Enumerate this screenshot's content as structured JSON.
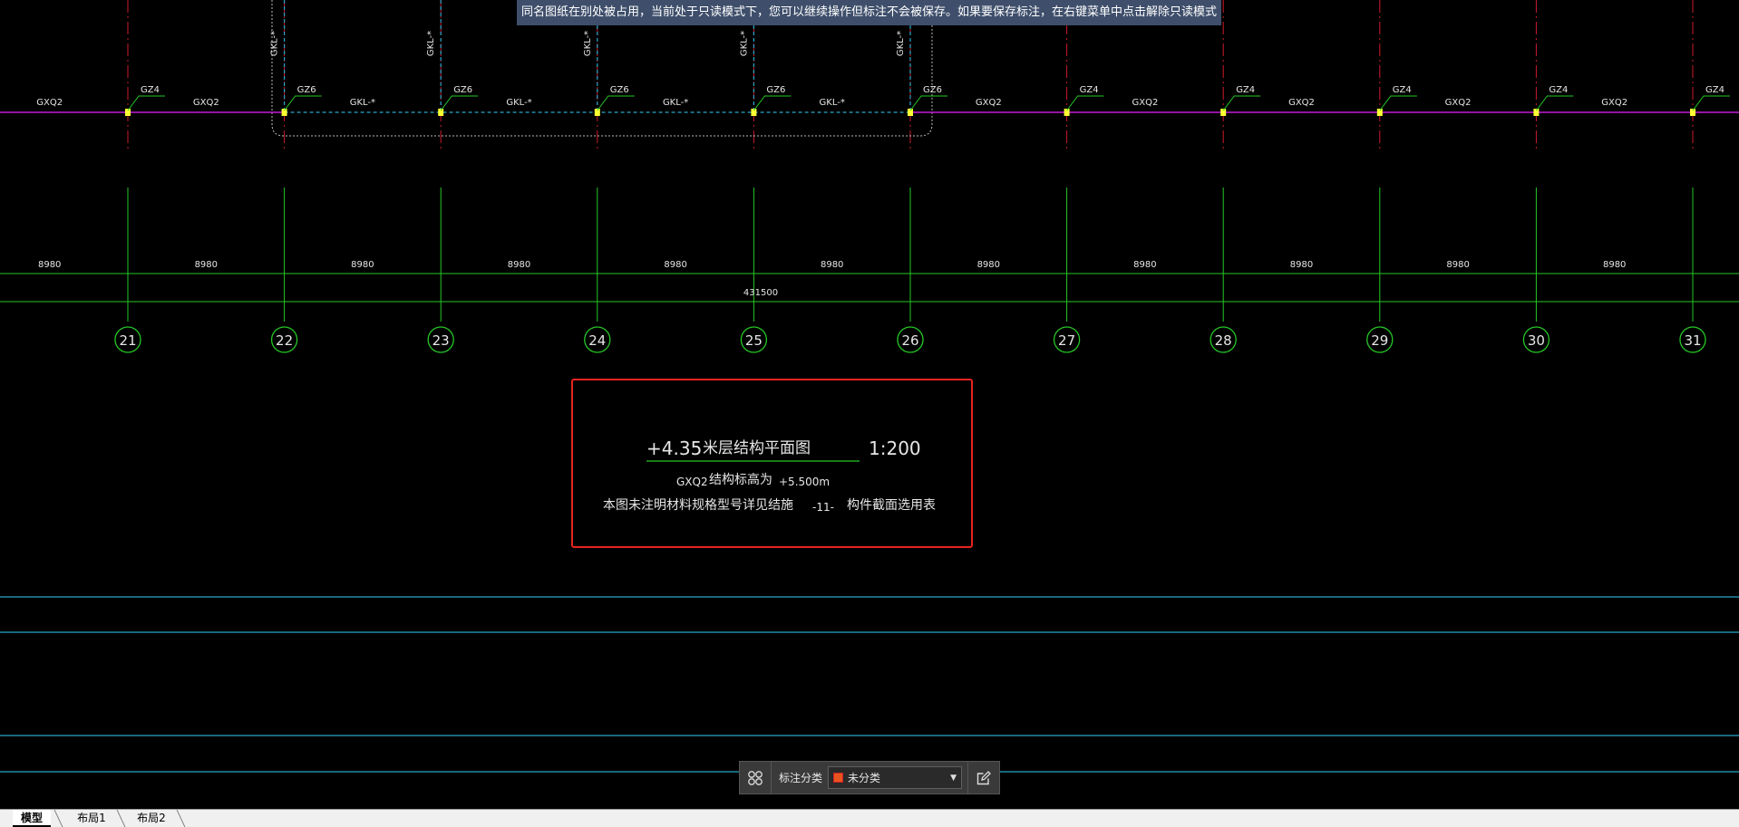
{
  "notice": "同名图纸在别处被占用，当前处于只读模式下，您可以继续操作但标注不会被保存。如果要保存标注，在右键菜单中点击解除只读模式",
  "colors": {
    "background": "#000000",
    "grid_line": "#cc1b2b",
    "beam_line": "#c21ad6",
    "dimension_line": "#25c825",
    "axis_bubble": "#25c825",
    "frame_beam": "#2aa6c9",
    "highlight_box": "#e8231f",
    "column_marker": "#ffff33",
    "text": "#e6e6e6"
  },
  "axes": [
    "21",
    "22",
    "23",
    "24",
    "25",
    "26",
    "27",
    "28",
    "29",
    "30",
    "31"
  ],
  "column_labels": [
    "GZ4",
    "GZ6",
    "GZ6",
    "GZ6",
    "GZ6",
    "GZ6",
    "GZ4",
    "GZ4",
    "GZ4",
    "GZ4",
    "GZ4"
  ],
  "beam_labels": [
    "GXQ2",
    "GXQ2",
    "GKL-*",
    "GKL-*",
    "GKL-*",
    "GKL-*",
    "GXQ2",
    "GXQ2",
    "GXQ2",
    "GXQ2",
    "GXQ2"
  ],
  "vertical_beam_labels": [
    "GKL-*",
    "GKL-*",
    "GKL-*",
    "GKL-*",
    "GKL-*"
  ],
  "span_dims": [
    "8980",
    "8980",
    "8980",
    "8980",
    "8980",
    "8980",
    "8980",
    "8980",
    "8980",
    "8980",
    "8980"
  ],
  "total_dim": "431500",
  "title_block": {
    "elevation": "+4.35",
    "title": "米层结构平面图",
    "scale": "1:200",
    "note1_label": "GXQ2",
    "note1_text": "结构标高为",
    "note1_value": "+5.500m",
    "note2_text": "本图未注明材料规格型号详见结施",
    "note2_ref": "-11-",
    "note2_tail": "构件截面选用表"
  },
  "annotation_bar": {
    "grid_icon": "grid-icon",
    "label": "标注分类",
    "selected": "未分类",
    "swatch_color": "#e8541f",
    "edit_icon": "edit-icon"
  },
  "tabs": [
    "模型",
    "布局1",
    "布局2"
  ]
}
